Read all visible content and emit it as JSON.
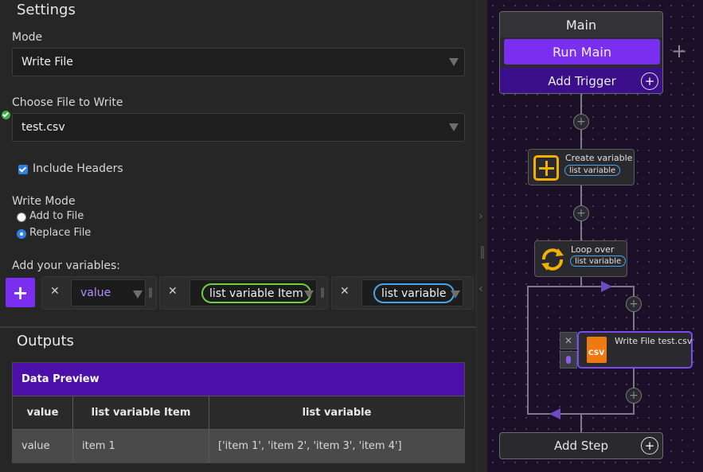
{
  "settings": {
    "title": "Settings",
    "mode_label": "Mode",
    "mode_value": "Write File",
    "file_label": "Choose File to Write",
    "file_value": "test.csv",
    "include_headers_label": "Include Headers",
    "include_headers_checked": true,
    "write_mode_label": "Write Mode",
    "write_mode_options": [
      "Add to File",
      "Replace File"
    ],
    "write_mode_selected": "Replace File",
    "variables_label": "Add your variables:",
    "add_button": "+",
    "remove_glyph": "✕",
    "variables": [
      {
        "value": "value",
        "style": "plain"
      },
      {
        "value": "list variable Item",
        "style": "pill-green"
      },
      {
        "value": "list variable",
        "style": "pill-blue"
      }
    ]
  },
  "outputs": {
    "title": "Outputs",
    "preview_title": "Data Preview",
    "columns": [
      "value",
      "list variable Item",
      "list variable"
    ],
    "rows": [
      [
        "value",
        "item 1",
        "['item 1', 'item 2', 'item 3', 'item 4']"
      ]
    ]
  },
  "flow": {
    "main_title": "Main",
    "run_main": "Run Main",
    "add_trigger": "Add Trigger",
    "side_plus": "+",
    "steps": [
      {
        "title": "Create variable",
        "tag": "list variable",
        "icon": "plus-square-icon"
      },
      {
        "title": "Loop over",
        "tag": "list variable",
        "icon": "loop-icon"
      },
      {
        "title": "Write File test.csv",
        "icon": "csv-file-icon",
        "icon_text": "CSV"
      }
    ],
    "add_step": "Add Step",
    "node_plus": "+"
  },
  "colors": {
    "accent_purple": "#7a2ff0",
    "table_header": "#4c0fa8",
    "loop_yellow": "#f4b000",
    "csv_orange": "#f07a12",
    "pill_green": "#6fcf3f",
    "pill_blue": "#4aa3e8"
  }
}
